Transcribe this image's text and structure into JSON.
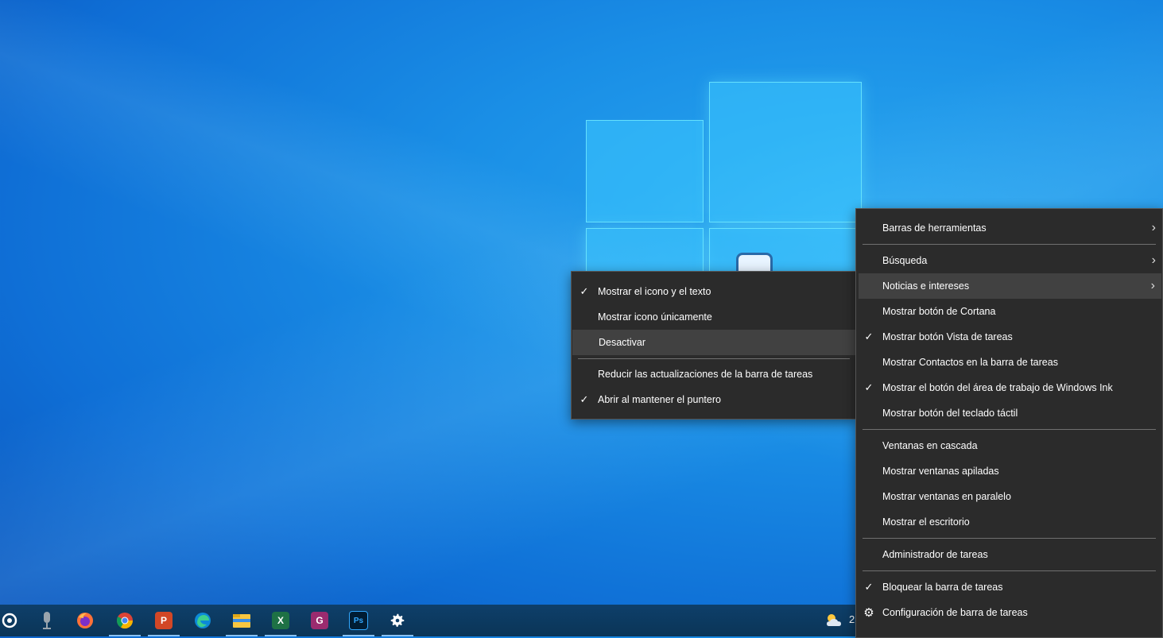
{
  "main_menu": {
    "items": [
      {
        "label": "Barras de herramientas",
        "checked": false,
        "submenu": true
      },
      {
        "label": "Búsqueda",
        "checked": false,
        "submenu": true
      },
      {
        "label": "Noticias e intereses",
        "checked": false,
        "submenu": true,
        "highlighted": true
      },
      {
        "label": "Mostrar botón de Cortana",
        "checked": false
      },
      {
        "label": "Mostrar botón Vista de tareas",
        "checked": true
      },
      {
        "label": "Mostrar Contactos en la barra de tareas",
        "checked": false
      },
      {
        "label": "Mostrar el botón del área de trabajo de Windows Ink",
        "checked": true
      },
      {
        "label": "Mostrar botón del teclado táctil",
        "checked": false
      },
      {
        "label": "Ventanas en cascada",
        "checked": false
      },
      {
        "label": "Mostrar ventanas apiladas",
        "checked": false
      },
      {
        "label": "Mostrar ventanas en paralelo",
        "checked": false
      },
      {
        "label": "Mostrar el escritorio",
        "checked": false
      },
      {
        "label": "Administrador de tareas",
        "checked": false
      },
      {
        "label": "Bloquear la barra de tareas",
        "checked": true
      },
      {
        "label": "Configuración de barra de tareas",
        "checked": false,
        "icon": "gear-icon"
      }
    ]
  },
  "sub_menu": {
    "items": [
      {
        "label": "Mostrar el icono y el texto",
        "checked": true
      },
      {
        "label": "Mostrar icono únicamente",
        "checked": false
      },
      {
        "label": "Desactivar",
        "checked": false,
        "highlighted": true
      },
      {
        "label": "Reducir las actualizaciones de la barra de tareas",
        "checked": false
      },
      {
        "label": "Abrir al mantener el puntero",
        "checked": true
      }
    ]
  },
  "taskbar": {
    "apps": [
      {
        "name": "cortana-icon"
      },
      {
        "name": "microphone-icon"
      },
      {
        "name": "firefox-icon"
      },
      {
        "name": "chrome-icon",
        "active": true
      },
      {
        "name": "powerpoint-icon",
        "active": true
      },
      {
        "name": "edge-icon"
      },
      {
        "name": "file-explorer-icon",
        "active": true
      },
      {
        "name": "excel-icon",
        "active": true
      },
      {
        "name": "pdf-app-icon"
      },
      {
        "name": "photoshop-icon",
        "active": true
      },
      {
        "name": "settings-icon",
        "active": true
      }
    ],
    "tray_text": "2",
    "excel_letter": "X",
    "powerpoint_letter": "P",
    "photoshop_letters": "Ps",
    "pdf_letter": "G"
  },
  "glyphs": {
    "check": "✓",
    "arrow": "›",
    "gear": "⚙"
  },
  "colors": {
    "menu_bg": "#2b2b2b",
    "menu_highlight": "#414141",
    "taskbar_bg": "#0e3f6a"
  }
}
